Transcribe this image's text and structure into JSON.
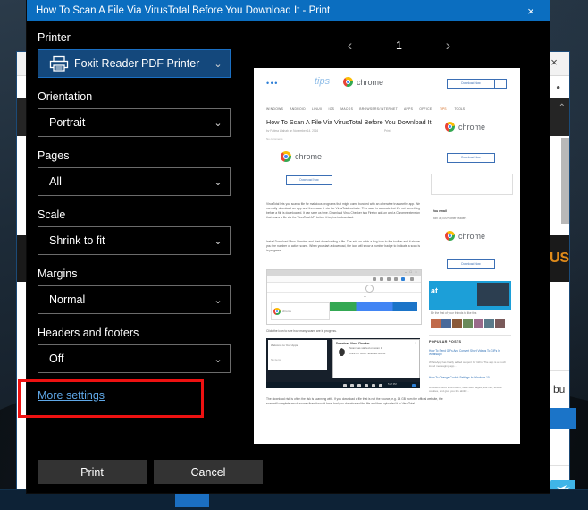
{
  "window": {
    "title": "How To Scan A File Via VirusTotal Before You Download It - Print",
    "close_icon": "×"
  },
  "settings": {
    "printer": {
      "label": "Printer",
      "value": "Foxit Reader PDF Printer",
      "icon": "printer-icon",
      "chevron": "⌄"
    },
    "orientation": {
      "label": "Orientation",
      "value": "Portrait",
      "chevron": "⌄"
    },
    "pages": {
      "label": "Pages",
      "value": "All",
      "chevron": "⌄"
    },
    "scale": {
      "label": "Scale",
      "value": "Shrink to fit",
      "chevron": "⌄"
    },
    "margins": {
      "label": "Margins",
      "value": "Normal",
      "chevron": "⌄"
    },
    "headers_footers": {
      "label": "Headers and footers",
      "value": "Off",
      "chevron": "⌄"
    },
    "more_settings_link": "More settings"
  },
  "buttons": {
    "print": "Print",
    "cancel": "Cancel"
  },
  "preview": {
    "prev_arrow": "‹",
    "next_arrow": "›",
    "page_number": "1",
    "page": {
      "brand_dots": "•••",
      "brand_tips": "tips",
      "brand_chrome": "chrome",
      "header_download_btn": "Download Now",
      "nav_items": [
        "WINDOWS",
        "ANDROID",
        "LINUX",
        "IOS",
        "MACOS",
        "BROWSERS/INTERNET",
        "APPS",
        "OFFICE"
      ],
      "nav_right": [
        "TIPS",
        "TOOLS"
      ],
      "article_title": "How To Scan A File Via VirusTotal Before You Download It",
      "byline": "by Fatima Wahab on November 14, 2016",
      "print_label": "Print",
      "subline": "No comments",
      "chrome_word_2": "chrome",
      "download_btn_2": "Download Now",
      "paragraph_1": "VirusTotal lets you scan a file for malicious programs that might come bundled with an otherwise trustworthy app. We normally download an app and then scan it via the VirusTotal website. This scan is accurate but it's not something before a file is downloaded. It can save us time. Download Virus Checker is a Firefox add-on and a Chrome extension that scans a file via the VirusTotal API before it begins to download.",
      "paragraph_2": "Install Download Virus Checker and start downloading a file. The add-on adds a bug icon to the toolbar and it shows you the number of active scans. When you start a download, the icon will show a number badge to indicate a scan is in progress.",
      "caption_1": "Click the icon to see how many scans are in progress.",
      "popup_title": "Download Virus Checker",
      "popup_line_1": "Scan has started on scan 1",
      "popup_line_2": "Click on 'Abort' affected scans.",
      "paragraph_3": "The download risk is often the risk is scanning with. If you download a file that is not the source, e.g. 14 GB from the official website, the scan will complete much sooner than it would have had you downloaded the file and then uploaded it to VirusTotal.",
      "sidebar": {
        "download_btn_top": "Download Now",
        "chrome_word": "chrome",
        "download_btn_mid": "Download Now",
        "email_label": "You email",
        "email_sub": "Join 30,000+ other readers",
        "chrome_word_2": "chrome",
        "download_btn_bottom": "Download Now",
        "ad_badge": "at",
        "ad_caption": "Be the first of your friends to like this",
        "popular_heading": "POPULAR POSTS",
        "popular": [
          {
            "title": "How To Send GIFs And Convert Short Videos To GIFs In WhatsApp",
            "body": "WhatsApp has finally added support for GIFs. The app is a much loved messaging app..."
          },
          {
            "title": "How To Change Cookie Settings In Windows 10",
            "body": "Browsers store information, save web pages, site info, enable cookies, and give you the ability..."
          }
        ]
      }
    }
  },
  "background": {
    "browser_close_icon": "×",
    "browser_dots": "• • •",
    "orange_text": "US",
    "small_text": "bu"
  },
  "colors": {
    "titlebar_blue": "#0b6ec0",
    "accent_blue": "#14487c",
    "link_blue": "#5fa8e8",
    "annotation_red": "#ee1111",
    "dialog_black": "#000000",
    "button_gray": "#333333"
  }
}
